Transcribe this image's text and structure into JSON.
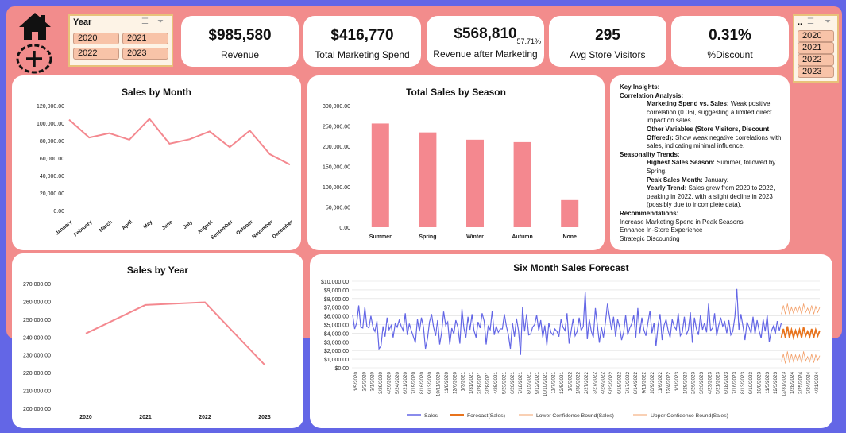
{
  "year_slicer": {
    "title": "Year",
    "options": [
      "2020",
      "2021",
      "2022",
      "2023"
    ]
  },
  "right_slicer": {
    "title": "..",
    "options": [
      "2020",
      "2021",
      "2022",
      "2023"
    ]
  },
  "kpis": [
    {
      "value": "$985,580",
      "label": "Revenue",
      "note": ""
    },
    {
      "value": "$416,770",
      "label": "Total Marketing Spend",
      "note": ""
    },
    {
      "value": "$568,810",
      "label": "Revenue after Marketing",
      "note": "57.71%"
    },
    {
      "value": "295",
      "label": "Avg Store Visitors",
      "note": ""
    },
    {
      "value": "0.31%",
      "label": "%Discount",
      "note": ""
    }
  ],
  "insights": {
    "heading": "Key Insights:",
    "correlation_heading": "Correlation Analysis:",
    "marketing_bold": "Marketing Spend vs. Sales:",
    "marketing_text": " Weak positive correlation (0.06), suggesting a limited direct impact on sales.",
    "other_bold": "Other Variables (Store Visitors, Discount Offered):",
    "other_text": " Show weak negative correlations with sales, indicating minimal influence.",
    "seasonality_heading": "Seasonality Trends:",
    "highest_bold": "Highest Sales Season:",
    "highest_text": " Summer, followed by Spring.",
    "peak_bold": "Peak Sales Month:",
    "peak_text": " January.",
    "yearly_bold": "Yearly Trend:",
    "yearly_text": " Sales grew from 2020 to 2022, peaking in 2022, with a slight decline in 2023 (possibly due to incomplete data).",
    "recommendations_heading": "Recommendations:",
    "rec1": "Increase Marketing Spend in Peak Seasons",
    "rec2": "Enhance In-Store Experience",
    "rec3": "Strategic Discounting"
  },
  "chart_data": [
    {
      "type": "line",
      "title": "Sales by Month",
      "categories": [
        "January",
        "February",
        "March",
        "April",
        "May",
        "June",
        "July",
        "August",
        "September",
        "October",
        "November",
        "December"
      ],
      "values": [
        104000,
        83500,
        88500,
        81000,
        105000,
        76500,
        81500,
        90500,
        72500,
        91500,
        64500,
        52500
      ],
      "yticks": [
        "0.00",
        "20,000.00",
        "40,000.00",
        "60,000.00",
        "80,000.00",
        "100,000.00",
        "120,000.00"
      ],
      "ylim": [
        0,
        120000
      ],
      "color": "#f4888f"
    },
    {
      "type": "bar",
      "title": "Total Sales by Season",
      "categories": [
        "Summer",
        "Spring",
        "Winter",
        "Autumn",
        "None"
      ],
      "values": [
        256000,
        234000,
        216000,
        210000,
        67000
      ],
      "yticks": [
        "0.00",
        "50,000.00",
        "100,000.00",
        "150,000.00",
        "200,000.00",
        "250,000.00",
        "300,000.00"
      ],
      "ylim": [
        0,
        300000
      ],
      "color": "#f4888f"
    },
    {
      "type": "line",
      "title": "Sales by Year",
      "categories": [
        "2020",
        "2021",
        "2022",
        "2023"
      ],
      "values": [
        242000,
        258000,
        259500,
        224500
      ],
      "yticks": [
        "200,000.00",
        "210,000.00",
        "220,000.00",
        "230,000.00",
        "240,000.00",
        "250,000.00",
        "260,000.00",
        "270,000.00"
      ],
      "ylim": [
        200000,
        270000
      ],
      "color": "#f4888f"
    },
    {
      "type": "line",
      "title": "Six Month Sales Forecast",
      "yticks": [
        "$0.00",
        "$1,000.00",
        "$2,000.00",
        "$3,000.00",
        "$4,000.00",
        "$5,000.00",
        "$6,000.00",
        "$7,000.00",
        "$8,000.00",
        "$9,000.00",
        "$10,000.00"
      ],
      "ylim": [
        0,
        10000
      ],
      "xticks": [
        "1/5/2020",
        "2/2/2020",
        "3/1/2020",
        "3/29/2020",
        "4/26/2020",
        "5/24/2020",
        "6/21/2020",
        "7/19/2020",
        "8/16/2020",
        "9/13/2020",
        "10/11/2020",
        "11/8/2020",
        "12/6/2020",
        "1/3/2021",
        "1/31/2021",
        "2/28/2021",
        "3/28/2021",
        "4/25/2021",
        "5/23/2021",
        "6/20/2021",
        "7/18/2021",
        "8/15/2021",
        "9/12/2021",
        "10/10/2021",
        "11/7/2021",
        "12/5/2021",
        "1/2/2022",
        "1/30/2022",
        "2/27/2022",
        "3/27/2022",
        "4/24/2022",
        "5/22/2022",
        "6/19/2022",
        "7/17/2022",
        "8/14/2022",
        "9/11/2022",
        "10/9/2022",
        "11/6/2022",
        "12/4/2022",
        "1/1/2023",
        "1/29/2023",
        "2/26/2023",
        "3/26/2023",
        "4/23/2023",
        "5/21/2023",
        "6/18/2023",
        "7/16/2023",
        "8/13/2023",
        "9/10/2023",
        "10/8/2023",
        "11/5/2023",
        "12/3/2023",
        "12/31/2023",
        "1/28/2024",
        "2/25/2024",
        "3/24/2024",
        "4/21/2024"
      ],
      "legend": [
        "Sales",
        "Forecast(Sales)",
        "Lower Confidence Bound(Sales)",
        "Upper Confidence Bound(Sales)"
      ],
      "legend_position": "bottom",
      "series": [
        {
          "name": "Sales",
          "color": "#6366e6",
          "values": [
            6100,
            4500,
            5200,
            7200,
            4700,
            4600,
            7000,
            4800,
            4600,
            6000,
            4700,
            4200,
            5400,
            2200,
            2500,
            4800,
            3600,
            5800,
            4400,
            4900,
            3500,
            5100,
            4700,
            5500,
            4800,
            4300,
            6300,
            3800,
            5100,
            4300,
            3600,
            2900,
            5600,
            4200,
            5800,
            4700,
            2200,
            3400,
            5300,
            6200,
            4700,
            3700,
            5500,
            2700,
            4100,
            6500,
            4900,
            5300,
            2700,
            4600,
            3900,
            5500,
            4700,
            2800,
            6800,
            4600,
            3500,
            5900,
            4400,
            6200,
            4300,
            3500,
            5300,
            4600,
            6300,
            5400,
            2700,
            4800,
            4400,
            6600,
            3800,
            4800,
            4100,
            4500,
            4500,
            6200,
            4800,
            3800,
            2200,
            5200,
            3600,
            5700,
            4300,
            1500,
            7000,
            4200,
            6200,
            3800,
            3900,
            4700,
            5000,
            6100,
            4300,
            5500,
            3500,
            4900,
            2600,
            5200,
            4100,
            3800,
            4500,
            4200,
            3600,
            5600,
            4700,
            4300,
            6300,
            2800,
            4200,
            5700,
            3700,
            4200,
            5800,
            4300,
            4800,
            8800,
            3300,
            5600,
            4200,
            3500,
            6900,
            4900,
            2900,
            4700,
            3500,
            5300,
            7400,
            5900,
            4400,
            5900,
            3600,
            5600,
            4700,
            3200,
            4100,
            6100,
            3800,
            4600,
            5100,
            6100,
            3500,
            6900,
            4000,
            5800,
            4400,
            3700,
            5200,
            6600,
            4000,
            5200,
            2500,
            4900,
            6200,
            3200,
            4900,
            5600,
            4300,
            3500,
            5600,
            4800,
            4400,
            6300,
            3700,
            4100,
            5900,
            3800,
            4400,
            6400,
            2900,
            5800,
            4500,
            3800,
            6100,
            4400,
            5200,
            4100,
            7400,
            4300,
            4600,
            6300,
            3700,
            4900,
            5800,
            4800,
            5300,
            4000,
            5500,
            3800,
            4200,
            5900,
            9100,
            4400,
            6200,
            4800,
            3200,
            5300,
            4700,
            4000,
            5900,
            3900,
            5500,
            4300,
            3400,
            5600,
            4200,
            6100,
            3000,
            4200,
            4800,
            3900,
            5400,
            4300,
            5200
          ]
        },
        {
          "name": "Forecast(Sales)",
          "color": "#e8731c",
          "values": [
            3500,
            4500,
            3500,
            4800,
            3500,
            4400,
            3500,
            4300,
            3600,
            4400,
            3500,
            4700,
            3700,
            4200,
            3600,
            4500,
            3500,
            4400,
            3700,
            4300
          ]
        },
        {
          "name": "Lower Confidence Bound(Sales)",
          "color": "#f3a06a",
          "values": [
            700,
            1600,
            500,
            1900,
            600,
            1600,
            700,
            1500,
            800,
            1500,
            600,
            1900,
            800,
            1300,
            700,
            1600,
            600,
            1500,
            900,
            1400
          ]
        },
        {
          "name": "Upper Confidence Bound(Sales)",
          "color": "#f3a06a",
          "values": [
            6200,
            7200,
            6200,
            7400,
            6200,
            7000,
            6300,
            7000,
            6400,
            7100,
            6200,
            7400,
            6400,
            6900,
            6300,
            7200,
            6200,
            7100,
            6400,
            7000
          ]
        }
      ]
    }
  ]
}
